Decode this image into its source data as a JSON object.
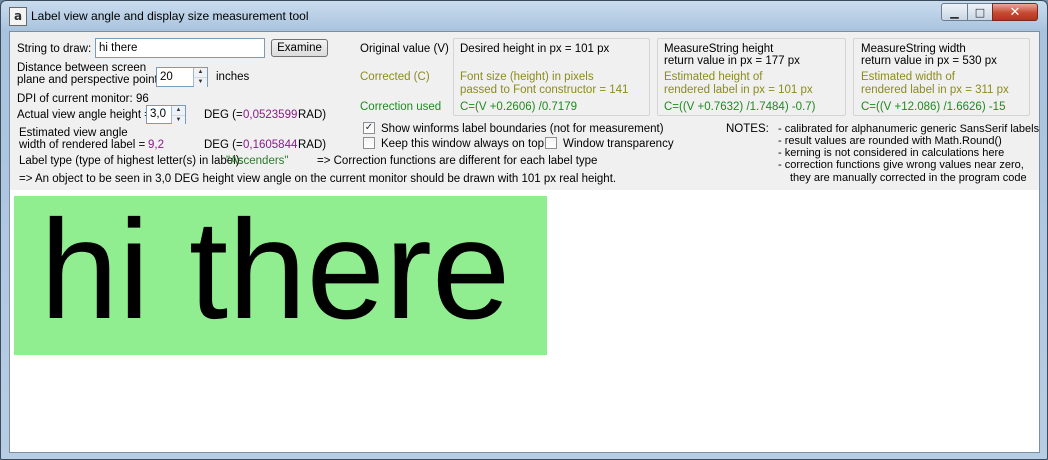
{
  "window": {
    "title": "Label view angle and display size measurement tool",
    "app_icon": "a",
    "minimize": "▁",
    "maximize": "□",
    "close": "✕"
  },
  "form": {
    "string_label": "String to draw:",
    "string_value": "hi there",
    "examine": "Examine",
    "distance_label_1": "Distance between screen",
    "distance_label_2": "plane and perspective point:",
    "distance_value": "20",
    "distance_unit": "inches",
    "dpi_label": "DPI of current monitor:",
    "dpi_value": "96",
    "angle_label": "Actual view angle height =",
    "angle_value": "3,0",
    "angle_deg": "DEG (=",
    "angle_rad_value": "0,0523599",
    "angle_rad_unit": "RAD)",
    "est_label_1": "Estimated view angle",
    "est_label_2": "width of rendered label =",
    "est_value": "9,2",
    "est_deg": "DEG (=",
    "est_rad_value": "0,1605844",
    "est_rad_unit": "RAD)",
    "label_type_text": "Label type (type of highest letter(s) in label):",
    "label_type_value": "\"Ascenders\"",
    "label_type_note": "=> Correction functions are different for each label type",
    "summary": "=> An object to be seen in 3,0 DEG height view angle on the current monitor should be drawn with 101 px real height."
  },
  "legend": {
    "original": "Original value (V)",
    "corrected": "Corrected (C)",
    "correction_used": "Correction used"
  },
  "col_desired": {
    "header": "Desired height in px = 101 px",
    "corr_1": "Font size (height) in pixels",
    "corr_2": "passed to Font constructor = 141",
    "formula": "C=(V +0.2606) /0.7179"
  },
  "col_height": {
    "header_1": "MeasureString height",
    "header_2": "return value in px =  177 px",
    "corr_1": "Estimated height of",
    "corr_2": "rendered label in px =  101 px",
    "formula": "C=((V +0.7632) /1.7484) -0.7)"
  },
  "col_width": {
    "header_1": "MeasureString width",
    "header_2": "return value in px = 530 px",
    "corr_1": "Estimated width of",
    "corr_2": "rendered label in px = 311 px",
    "formula": "C=((V +12.086) /1.6626) -15"
  },
  "options": {
    "show_boundaries": "Show winforms label boundaries (not for measurement)",
    "always_on_top": "Keep this window always on top",
    "transparency": "Window transparency",
    "check_mark": "✓"
  },
  "notes": {
    "title": "NOTES:",
    "n1": "- calibrated for alphanumeric generic SansSerif labels",
    "n2": "- result values are rounded with Math.Round()",
    "n3": "- kerning is not considered in calculations here",
    "n4": "- correction functions give wrong values near zero,",
    "n5": "they are manually corrected in the program code"
  },
  "render": {
    "text": "hi there"
  },
  "colors": {
    "label_bg": "#90ee90",
    "corrected_text": "#8c8c1a",
    "formula_text": "#1f8a1f",
    "rad_text": "#8b1a8b"
  }
}
